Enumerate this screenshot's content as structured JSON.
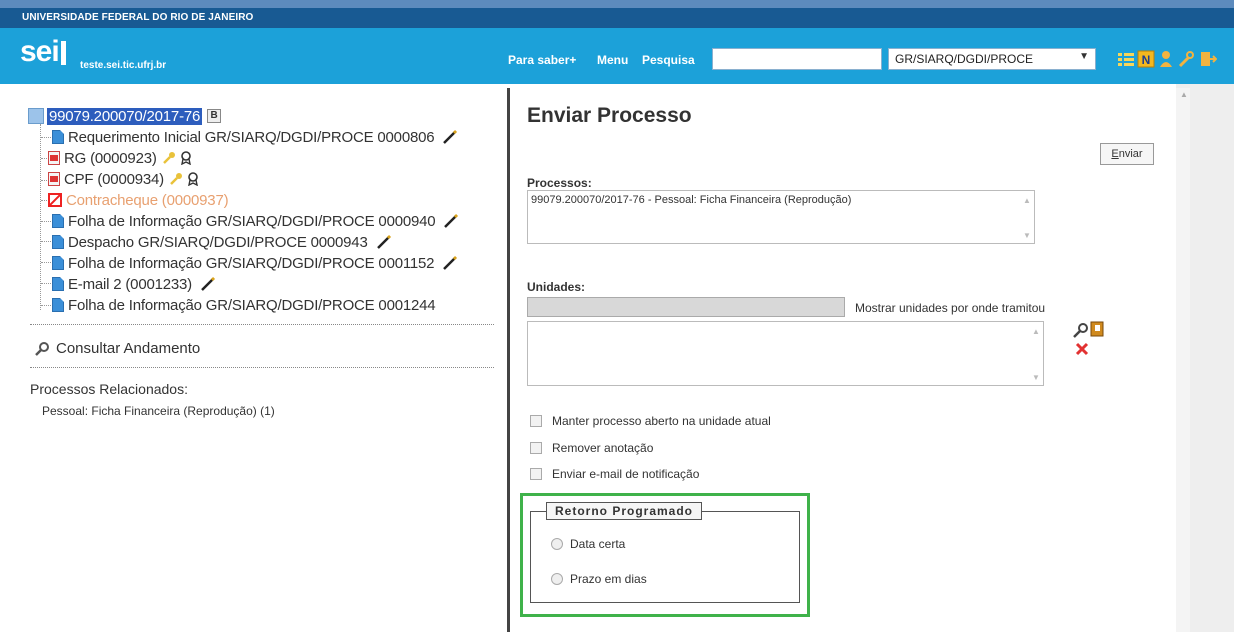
{
  "header": {
    "university": "UNIVERSIDADE FEDERAL DO RIO DE JANEIRO",
    "logo": "sei",
    "host": "teste.sei.tic.ufrj.br",
    "links": [
      "Para saber+",
      "Menu",
      "Pesquisa"
    ],
    "search_value": "",
    "unit_selected": "GR/SIARQ/DGDI/PROCE"
  },
  "tree": {
    "process_number": "99079.200070/2017-76",
    "badge": "B",
    "items": [
      {
        "label": "Requerimento Inicial GR/SIARQ/DGDI/PROCE 0000806",
        "icon": "document-icon"
      },
      {
        "label": "RG (0000923)",
        "icon": "pdf-icon"
      },
      {
        "label": "CPF (0000934)",
        "icon": "pdf-icon"
      },
      {
        "label": "Contracheque (0000937)",
        "icon": "canceled-icon"
      },
      {
        "label": "Folha de Informação GR/SIARQ/DGDI/PROCE 0000940",
        "icon": "document-icon"
      },
      {
        "label": "Despacho GR/SIARQ/DGDI/PROCE 0000943",
        "icon": "document-icon"
      },
      {
        "label": "Folha de Informação GR/SIARQ/DGDI/PROCE 0001152",
        "icon": "document-icon"
      },
      {
        "label": "E-mail 2 (0001233)",
        "icon": "document-icon"
      },
      {
        "label": "Folha de Informação GR/SIARQ/DGDI/PROCE 0001244",
        "icon": "document-icon"
      }
    ],
    "canceled_color": "#e8a070",
    "consultar": "Consultar Andamento",
    "related_title": "Processos Relacionados:",
    "related_item": "Pessoal: Ficha Financeira (Reprodução) (1)"
  },
  "form": {
    "title": "Enviar Processo",
    "submit_label_first": "E",
    "submit_label_rest": "nviar",
    "processos_label": "Processos:",
    "processos_value": "99079.200070/2017-76 - Pessoal: Ficha Financeira (Reprodução)",
    "unidades_label": "Unidades:",
    "unidades_value": "",
    "mostrar_label": "Mostrar unidades por onde tramitou",
    "options": [
      "Manter processo aberto na unidade atual",
      "Remover anotação",
      "Enviar e-mail de notificação"
    ],
    "retorno_legend": "Retorno Programado",
    "retorno_options": [
      "Data certa",
      "Prazo em dias"
    ],
    "highlight_color": "#3fb24a"
  }
}
